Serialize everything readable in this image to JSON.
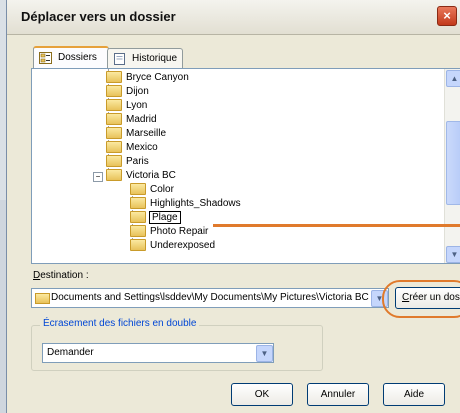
{
  "dialog": {
    "title": "Déplacer vers un dossier",
    "close_glyph": "×"
  },
  "tabs": [
    {
      "label": "Dossiers",
      "icon": "folders-icon"
    },
    {
      "label": "Historique",
      "icon": "history-icon"
    }
  ],
  "tree": {
    "items": [
      {
        "label": "Bryce Canyon"
      },
      {
        "label": "Dijon"
      },
      {
        "label": "Lyon"
      },
      {
        "label": "Madrid"
      },
      {
        "label": "Marseille"
      },
      {
        "label": "Mexico"
      },
      {
        "label": "Paris"
      },
      {
        "label": "Victoria BC",
        "expander": "−",
        "selected": true
      },
      {
        "label": "Color"
      },
      {
        "label": "Highlights_Shadows"
      },
      {
        "label": "Plage",
        "editing": true
      },
      {
        "label": "Photo Repair"
      },
      {
        "label": "Underexposed"
      }
    ]
  },
  "scroll": {
    "up": "▲",
    "down": "▼"
  },
  "destination": {
    "label_prefix": "D",
    "label_rest": "estination :",
    "path": "Documents and Settings\\lsddev\\My Documents\\My Pictures\\Victoria BC",
    "dropdown": "▼"
  },
  "create_button": {
    "accel": "C",
    "label_rest": "réer un dossier"
  },
  "overwrite": {
    "legend": "Écrasement des fichiers en double",
    "value": "Demander",
    "dropdown": "▼"
  },
  "buttons": {
    "ok": "OK",
    "cancel": "Annuler",
    "help": "Aide"
  },
  "colors": {
    "highlight": "#e07a2c",
    "selection": "#316ac5"
  }
}
